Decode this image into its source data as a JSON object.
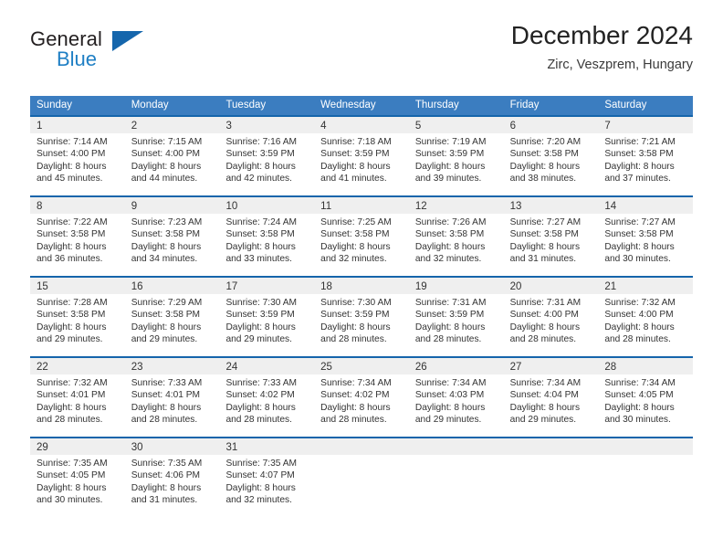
{
  "brand": {
    "name_part1": "General",
    "name_part2": "Blue",
    "flag_icon": "triangle-flag-icon"
  },
  "header": {
    "title": "December 2024",
    "location": "Zirc, Veszprem, Hungary"
  },
  "colors": {
    "header_blue": "#3b7dc0",
    "cell_top_border": "#1565ab",
    "day_band_gray": "#efefef",
    "brand_blue": "#1f7fc4"
  },
  "weekdays": [
    "Sunday",
    "Monday",
    "Tuesday",
    "Wednesday",
    "Thursday",
    "Friday",
    "Saturday"
  ],
  "weeks": [
    [
      {
        "day": "1",
        "sunrise": "Sunrise: 7:14 AM",
        "sunset": "Sunset: 4:00 PM",
        "daylight1": "Daylight: 8 hours",
        "daylight2": "and 45 minutes."
      },
      {
        "day": "2",
        "sunrise": "Sunrise: 7:15 AM",
        "sunset": "Sunset: 4:00 PM",
        "daylight1": "Daylight: 8 hours",
        "daylight2": "and 44 minutes."
      },
      {
        "day": "3",
        "sunrise": "Sunrise: 7:16 AM",
        "sunset": "Sunset: 3:59 PM",
        "daylight1": "Daylight: 8 hours",
        "daylight2": "and 42 minutes."
      },
      {
        "day": "4",
        "sunrise": "Sunrise: 7:18 AM",
        "sunset": "Sunset: 3:59 PM",
        "daylight1": "Daylight: 8 hours",
        "daylight2": "and 41 minutes."
      },
      {
        "day": "5",
        "sunrise": "Sunrise: 7:19 AM",
        "sunset": "Sunset: 3:59 PM",
        "daylight1": "Daylight: 8 hours",
        "daylight2": "and 39 minutes."
      },
      {
        "day": "6",
        "sunrise": "Sunrise: 7:20 AM",
        "sunset": "Sunset: 3:58 PM",
        "daylight1": "Daylight: 8 hours",
        "daylight2": "and 38 minutes."
      },
      {
        "day": "7",
        "sunrise": "Sunrise: 7:21 AM",
        "sunset": "Sunset: 3:58 PM",
        "daylight1": "Daylight: 8 hours",
        "daylight2": "and 37 minutes."
      }
    ],
    [
      {
        "day": "8",
        "sunrise": "Sunrise: 7:22 AM",
        "sunset": "Sunset: 3:58 PM",
        "daylight1": "Daylight: 8 hours",
        "daylight2": "and 36 minutes."
      },
      {
        "day": "9",
        "sunrise": "Sunrise: 7:23 AM",
        "sunset": "Sunset: 3:58 PM",
        "daylight1": "Daylight: 8 hours",
        "daylight2": "and 34 minutes."
      },
      {
        "day": "10",
        "sunrise": "Sunrise: 7:24 AM",
        "sunset": "Sunset: 3:58 PM",
        "daylight1": "Daylight: 8 hours",
        "daylight2": "and 33 minutes."
      },
      {
        "day": "11",
        "sunrise": "Sunrise: 7:25 AM",
        "sunset": "Sunset: 3:58 PM",
        "daylight1": "Daylight: 8 hours",
        "daylight2": "and 32 minutes."
      },
      {
        "day": "12",
        "sunrise": "Sunrise: 7:26 AM",
        "sunset": "Sunset: 3:58 PM",
        "daylight1": "Daylight: 8 hours",
        "daylight2": "and 32 minutes."
      },
      {
        "day": "13",
        "sunrise": "Sunrise: 7:27 AM",
        "sunset": "Sunset: 3:58 PM",
        "daylight1": "Daylight: 8 hours",
        "daylight2": "and 31 minutes."
      },
      {
        "day": "14",
        "sunrise": "Sunrise: 7:27 AM",
        "sunset": "Sunset: 3:58 PM",
        "daylight1": "Daylight: 8 hours",
        "daylight2": "and 30 minutes."
      }
    ],
    [
      {
        "day": "15",
        "sunrise": "Sunrise: 7:28 AM",
        "sunset": "Sunset: 3:58 PM",
        "daylight1": "Daylight: 8 hours",
        "daylight2": "and 29 minutes."
      },
      {
        "day": "16",
        "sunrise": "Sunrise: 7:29 AM",
        "sunset": "Sunset: 3:58 PM",
        "daylight1": "Daylight: 8 hours",
        "daylight2": "and 29 minutes."
      },
      {
        "day": "17",
        "sunrise": "Sunrise: 7:30 AM",
        "sunset": "Sunset: 3:59 PM",
        "daylight1": "Daylight: 8 hours",
        "daylight2": "and 29 minutes."
      },
      {
        "day": "18",
        "sunrise": "Sunrise: 7:30 AM",
        "sunset": "Sunset: 3:59 PM",
        "daylight1": "Daylight: 8 hours",
        "daylight2": "and 28 minutes."
      },
      {
        "day": "19",
        "sunrise": "Sunrise: 7:31 AM",
        "sunset": "Sunset: 3:59 PM",
        "daylight1": "Daylight: 8 hours",
        "daylight2": "and 28 minutes."
      },
      {
        "day": "20",
        "sunrise": "Sunrise: 7:31 AM",
        "sunset": "Sunset: 4:00 PM",
        "daylight1": "Daylight: 8 hours",
        "daylight2": "and 28 minutes."
      },
      {
        "day": "21",
        "sunrise": "Sunrise: 7:32 AM",
        "sunset": "Sunset: 4:00 PM",
        "daylight1": "Daylight: 8 hours",
        "daylight2": "and 28 minutes."
      }
    ],
    [
      {
        "day": "22",
        "sunrise": "Sunrise: 7:32 AM",
        "sunset": "Sunset: 4:01 PM",
        "daylight1": "Daylight: 8 hours",
        "daylight2": "and 28 minutes."
      },
      {
        "day": "23",
        "sunrise": "Sunrise: 7:33 AM",
        "sunset": "Sunset: 4:01 PM",
        "daylight1": "Daylight: 8 hours",
        "daylight2": "and 28 minutes."
      },
      {
        "day": "24",
        "sunrise": "Sunrise: 7:33 AM",
        "sunset": "Sunset: 4:02 PM",
        "daylight1": "Daylight: 8 hours",
        "daylight2": "and 28 minutes."
      },
      {
        "day": "25",
        "sunrise": "Sunrise: 7:34 AM",
        "sunset": "Sunset: 4:02 PM",
        "daylight1": "Daylight: 8 hours",
        "daylight2": "and 28 minutes."
      },
      {
        "day": "26",
        "sunrise": "Sunrise: 7:34 AM",
        "sunset": "Sunset: 4:03 PM",
        "daylight1": "Daylight: 8 hours",
        "daylight2": "and 29 minutes."
      },
      {
        "day": "27",
        "sunrise": "Sunrise: 7:34 AM",
        "sunset": "Sunset: 4:04 PM",
        "daylight1": "Daylight: 8 hours",
        "daylight2": "and 29 minutes."
      },
      {
        "day": "28",
        "sunrise": "Sunrise: 7:34 AM",
        "sunset": "Sunset: 4:05 PM",
        "daylight1": "Daylight: 8 hours",
        "daylight2": "and 30 minutes."
      }
    ],
    [
      {
        "day": "29",
        "sunrise": "Sunrise: 7:35 AM",
        "sunset": "Sunset: 4:05 PM",
        "daylight1": "Daylight: 8 hours",
        "daylight2": "and 30 minutes."
      },
      {
        "day": "30",
        "sunrise": "Sunrise: 7:35 AM",
        "sunset": "Sunset: 4:06 PM",
        "daylight1": "Daylight: 8 hours",
        "daylight2": "and 31 minutes."
      },
      {
        "day": "31",
        "sunrise": "Sunrise: 7:35 AM",
        "sunset": "Sunset: 4:07 PM",
        "daylight1": "Daylight: 8 hours",
        "daylight2": "and 32 minutes."
      },
      {
        "day": "",
        "sunrise": "",
        "sunset": "",
        "daylight1": "",
        "daylight2": ""
      },
      {
        "day": "",
        "sunrise": "",
        "sunset": "",
        "daylight1": "",
        "daylight2": ""
      },
      {
        "day": "",
        "sunrise": "",
        "sunset": "",
        "daylight1": "",
        "daylight2": ""
      },
      {
        "day": "",
        "sunrise": "",
        "sunset": "",
        "daylight1": "",
        "daylight2": ""
      }
    ]
  ]
}
